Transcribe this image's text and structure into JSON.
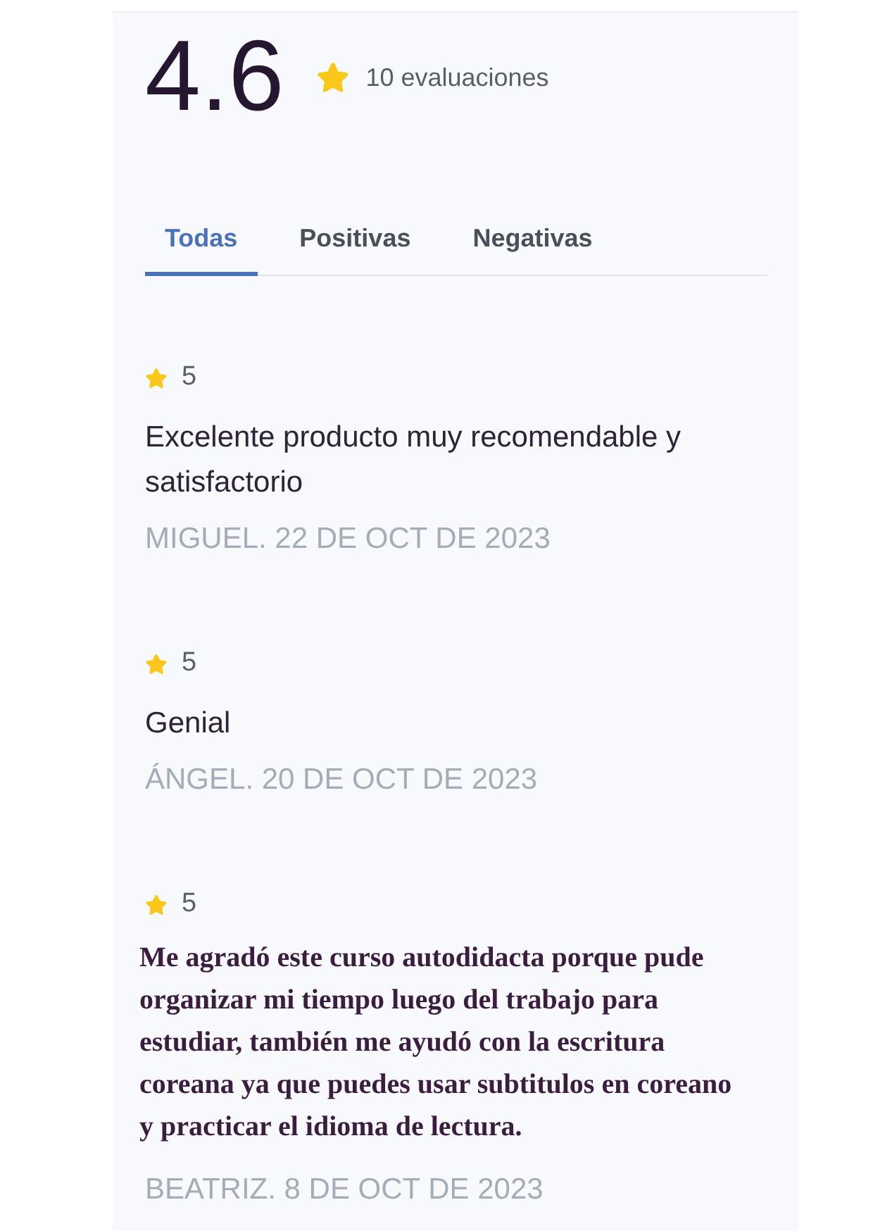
{
  "summary": {
    "score": "4.6",
    "count": "10 evaluaciones"
  },
  "tabs": [
    {
      "label": "Todas",
      "selected": true
    },
    {
      "label": "Positivas",
      "selected": false
    },
    {
      "label": "Negativas",
      "selected": false
    }
  ],
  "reviews": [
    {
      "rating": "5",
      "kind": "standard",
      "comment": "Excelente producto muy recomendable y satisfactorio",
      "byline": "MIGUEL. 22 DE OCT DE 2023"
    },
    {
      "rating": "5",
      "kind": "standard",
      "comment": "Genial",
      "byline": "ÁNGEL. 20 DE OCT DE 2023"
    },
    {
      "rating": "5",
      "kind": "formatted",
      "comment": "Me agradó este curso autodidacta porque pude organizar mi tiempo luego del trabajo para estudiar, también me ayudó con la escritura coreana ya que puedes usar subtitulos en coreano y practicar el idioma de lectura.",
      "byline": "BEATRIZ. 8 DE OCT DE 2023"
    }
  ]
}
